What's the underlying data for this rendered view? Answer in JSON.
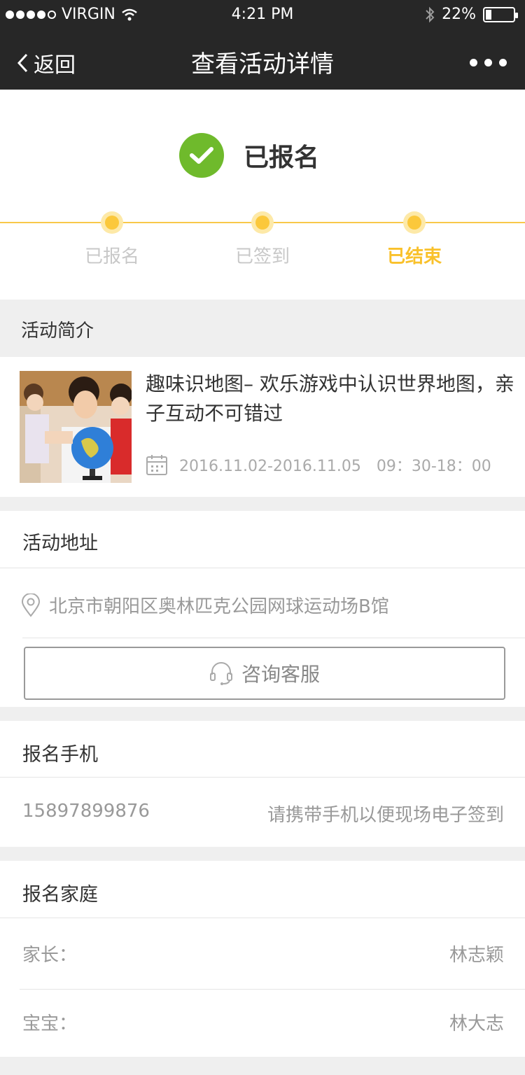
{
  "status_bar": {
    "carrier": "VIRGIN",
    "time": "4:21 PM",
    "battery": "22%",
    "battery_level": 0.22
  },
  "nav": {
    "back_label": "返回",
    "title": "查看活动详情",
    "more_icon": "ellipsis-icon"
  },
  "status": {
    "text": "已报名",
    "icon": "check-circle-icon",
    "accent": "#6fba2c",
    "progress_color": "#f9c12b",
    "steps": [
      {
        "label": "已报名"
      },
      {
        "label": "已签到"
      },
      {
        "label": "已结束"
      }
    ]
  },
  "intro": {
    "section_title": "活动简介",
    "title": "趣味识地图– 欢乐游戏中认识世界地图，亲子互动不可错过",
    "date_range": "2016.11.02-2016.11.05　09：30-18：00",
    "date_icon": "calendar-icon"
  },
  "address": {
    "section_title": "活动地址",
    "value": "北京市朝阳区奥林匹克公园网球运动场B馆",
    "icon": "location-pin-icon",
    "consult_label": "咨询客服",
    "consult_icon": "headset-icon"
  },
  "phone": {
    "section_title": "报名手机",
    "value": "15897899876",
    "hint": "请携带手机以便现场电子签到"
  },
  "family": {
    "section_title": "报名家庭",
    "parent_label": "家长：",
    "parent_value": "林志颖",
    "baby_label": "宝宝：",
    "baby_value": "林大志"
  }
}
